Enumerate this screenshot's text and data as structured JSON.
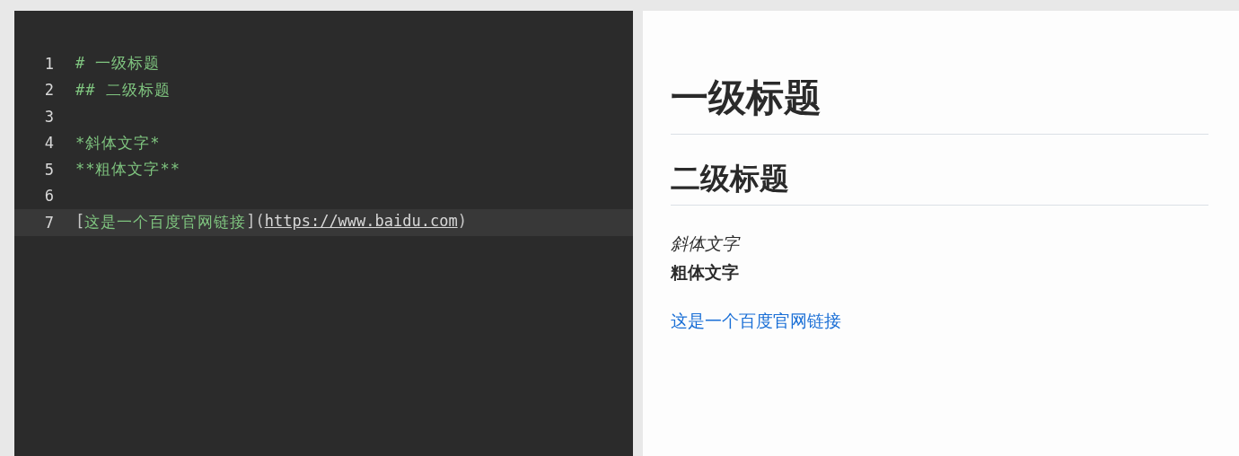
{
  "editor": {
    "lines": [
      {
        "number": "1",
        "selected": false,
        "segments": [
          {
            "text": "# 一级标题",
            "kind": "syntax"
          }
        ]
      },
      {
        "number": "2",
        "selected": false,
        "segments": [
          {
            "text": "## 二级标题",
            "kind": "syntax"
          }
        ]
      },
      {
        "number": "3",
        "selected": false
      },
      {
        "number": "4",
        "selected": false,
        "segments": [
          {
            "text": "*斜体文字*",
            "kind": "syntax"
          }
        ]
      },
      {
        "number": "5",
        "selected": false,
        "segments": [
          {
            "text": "**粗体文字**",
            "kind": "syntax"
          }
        ]
      },
      {
        "number": "6",
        "selected": false
      },
      {
        "number": "7",
        "selected": true,
        "segments": [
          {
            "text": "[",
            "kind": "punct"
          },
          {
            "text": "这是一个百度官网链接",
            "kind": "syntax"
          },
          {
            "text": "](",
            "kind": "punct"
          },
          {
            "text": "https://www.baidu.com",
            "kind": "url"
          },
          {
            "text": ")",
            "kind": "punct"
          }
        ]
      }
    ]
  },
  "preview": {
    "blocks": [
      {
        "kind": "h1",
        "text": "一级标题"
      },
      {
        "kind": "h2",
        "text": "二级标题"
      },
      {
        "kind": "em",
        "text": "斜体文字"
      },
      {
        "kind": "strong",
        "text": "粗体文字"
      },
      {
        "kind": "link",
        "text": "这是一个百度官网链接"
      }
    ]
  }
}
